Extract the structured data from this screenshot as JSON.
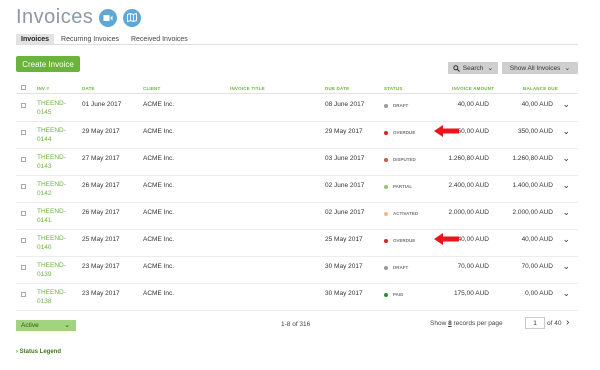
{
  "header": {
    "title": "Invoices"
  },
  "tabs": [
    "Invoices",
    "Recurring Invoices",
    "Received Invoices"
  ],
  "toolbar": {
    "create_label": "Create Invoice",
    "search_label": "Search",
    "showall_label": "Show All Invoices"
  },
  "columns": [
    "INV #",
    "DATE",
    "CLIENT",
    "INVOICE TITLE",
    "DUE DATE",
    "STATUS",
    "INVOICE AMOUNT",
    "BALANCE DUE"
  ],
  "rows": [
    {
      "inv": "THEEND-\n0145",
      "date": "01 June 2017",
      "client": "ACME Inc.",
      "title": "",
      "due": "08 June 2017",
      "status": "DRAFT",
      "status_color": "#999999",
      "amount": "40,00 AUD",
      "balance": "40,00 AUD",
      "arrow": false
    },
    {
      "inv": "THEEND-\n0144",
      "date": "29 May 2017",
      "client": "ACME Inc.",
      "title": "",
      "due": "29 May 2017",
      "status": "OVERDUE",
      "status_color": "#e02020",
      "amount": "350,00 AUD",
      "balance": "350,00 AUD",
      "arrow": true
    },
    {
      "inv": "THEEND-\n0143",
      "date": "27 May 2017",
      "client": "ACME Inc.",
      "title": "",
      "due": "03 June 2017",
      "status": "DISPUTED",
      "status_color": "#c0604a",
      "amount": "1.260,80 AUD",
      "balance": "1.260,80 AUD",
      "arrow": false
    },
    {
      "inv": "THEEND-\n0142",
      "date": "26 May 2017",
      "client": "ACME Inc.",
      "title": "",
      "due": "02 June 2017",
      "status": "PARTIAL",
      "status_color": "#8cc968",
      "amount": "2.400,00 AUD",
      "balance": "1.400,00 AUD",
      "arrow": false
    },
    {
      "inv": "THEEND-\n0141",
      "date": "26 May 2017",
      "client": "ACME Inc.",
      "title": "",
      "due": "02 June 2017",
      "status": "ACTIVATED",
      "status_color": "#f2b48a",
      "amount": "2.000,00 AUD",
      "balance": "2.000,00 AUD",
      "arrow": false
    },
    {
      "inv": "THEEND-\n0140",
      "date": "25 May 2017",
      "client": "ACME Inc.",
      "title": "",
      "due": "25 May 2017",
      "status": "OVERDUE",
      "status_color": "#e02020",
      "amount": "40,00 AUD",
      "balance": "40,00 AUD",
      "arrow": true
    },
    {
      "inv": "THEEND-\n0139",
      "date": "23 May 2017",
      "client": "ACME Inc.",
      "title": "",
      "due": "30 May 2017",
      "status": "DRAFT",
      "status_color": "#999999",
      "amount": "70,00 AUD",
      "balance": "70,00 AUD",
      "arrow": false
    },
    {
      "inv": "THEEND-\n0138",
      "date": "23 May 2017",
      "client": "ACME Inc.",
      "title": "",
      "due": "30 May 2017",
      "status": "PAID",
      "status_color": "#2e8b2e",
      "amount": "175,00 AUD",
      "balance": "0,00 AUD",
      "arrow": false
    }
  ],
  "footer": {
    "filter_label": "Active",
    "range_label": "1-8 of 316",
    "perpage_prefix": "Show",
    "perpage_value": "8",
    "perpage_suffix": "records per page",
    "page_value": "1",
    "page_of": "of 40"
  },
  "legend_label": "Status Legend",
  "colors": {
    "accent": "#6ab33d",
    "icon_blue": "#5fa8d6",
    "arrow_red": "#e8151b"
  }
}
